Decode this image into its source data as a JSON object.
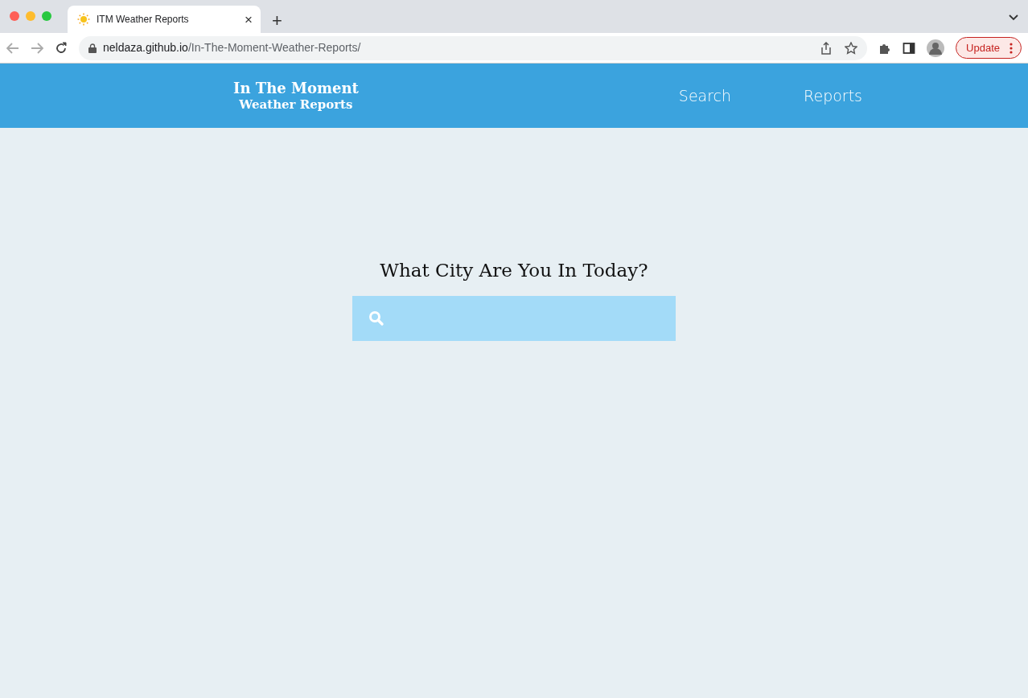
{
  "browser": {
    "tabs": [
      {
        "title": "ITM Weather Reports",
        "selected": true,
        "close": "×"
      }
    ],
    "new_tab": "+",
    "address": {
      "domain": "neldaza.github.io",
      "path": "/In-The-Moment-Weather-Reports/"
    },
    "update_button": "Update"
  },
  "site": {
    "logo": {
      "line_1": "In The Moment",
      "line_2": "Weather Reports"
    },
    "nav": [
      {
        "label": "Search"
      },
      {
        "label": "Reports"
      }
    ],
    "heading": "What City Are You In Today?"
  }
}
